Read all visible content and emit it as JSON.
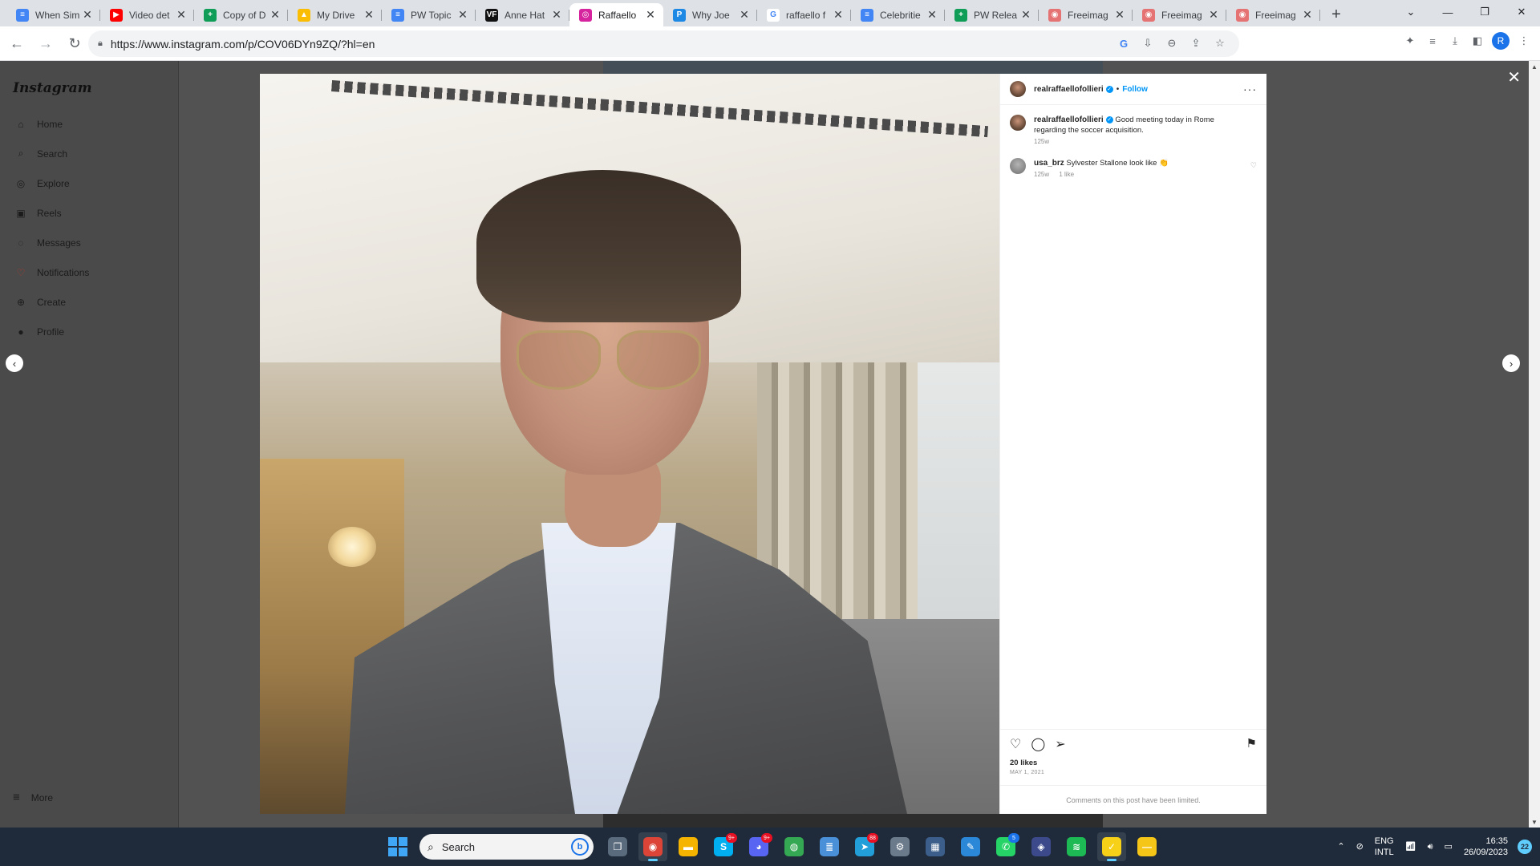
{
  "browser": {
    "tabs": [
      {
        "title": "When Sim",
        "color": "#4285f4",
        "glyph": "≡"
      },
      {
        "title": "Video det",
        "color": "#ff0000",
        "glyph": "▶"
      },
      {
        "title": "Copy of D",
        "color": "#0f9d58",
        "glyph": "+"
      },
      {
        "title": "My Drive",
        "color": "#fbbc04",
        "glyph": "▲"
      },
      {
        "title": "PW Topic",
        "color": "#4285f4",
        "glyph": "≡"
      },
      {
        "title": "Anne Hat",
        "color": "#111111",
        "glyph": "VF"
      },
      {
        "title": "Raffaello",
        "color": "#d6249f",
        "glyph": "◎"
      },
      {
        "title": "Why Joe",
        "color": "#1e88e5",
        "glyph": "P"
      },
      {
        "title": "raffaello f",
        "color": "#ffffff",
        "glyph": "G"
      },
      {
        "title": "Celebritie",
        "color": "#4285f4",
        "glyph": "≡"
      },
      {
        "title": "PW Relea",
        "color": "#0f9d58",
        "glyph": "+"
      },
      {
        "title": "Freeimag",
        "color": "#e57373",
        "glyph": "◉"
      },
      {
        "title": "Freeimag",
        "color": "#e57373",
        "glyph": "◉"
      },
      {
        "title": "Freeimag",
        "color": "#e57373",
        "glyph": "◉"
      }
    ],
    "active_tab_index": 6,
    "url": "https://www.instagram.com/p/COV06DYn9ZQ/?hl=en",
    "profile_initial": "R"
  },
  "instagram": {
    "logo": "Instagram",
    "nav": [
      {
        "label": "Home",
        "icon": "home-icon",
        "glyph": "⌂"
      },
      {
        "label": "Search",
        "icon": "search-icon",
        "glyph": "⌕"
      },
      {
        "label": "Explore",
        "icon": "compass-icon",
        "glyph": "◎"
      },
      {
        "label": "Reels",
        "icon": "reels-icon",
        "glyph": "▣"
      },
      {
        "label": "Messages",
        "icon": "messenger-icon",
        "glyph": "◌"
      },
      {
        "label": "Notifications",
        "icon": "heart-icon",
        "glyph": "♡"
      },
      {
        "label": "Create",
        "icon": "plus-icon",
        "glyph": "⊕"
      },
      {
        "label": "Profile",
        "icon": "profile-avatar",
        "glyph": "●"
      }
    ],
    "more_label": "More",
    "post": {
      "username": "realraffaellofollieri",
      "follow_label": "Follow",
      "caption": "Good meeting today in Rome regarding the soccer acquisition.",
      "caption_age": "125w",
      "comments": [
        {
          "username": "usa_brz",
          "text": "Sylvester Stallone look like 👏",
          "age": "125w",
          "likes": "1 like"
        }
      ],
      "likes": "20 likes",
      "date": "MAY 1, 2021",
      "comments_limited": "Comments on this post have been limited."
    }
  },
  "taskbar": {
    "search_placeholder": "Search",
    "apps": [
      {
        "name": "task-view",
        "color": "#5a6b7d",
        "glyph": "❐",
        "badge": ""
      },
      {
        "name": "chrome",
        "color": "#db4437",
        "glyph": "◉",
        "badge": "",
        "active": true
      },
      {
        "name": "file-explorer",
        "color": "#f4b400",
        "glyph": "▬",
        "badge": ""
      },
      {
        "name": "skype",
        "color": "#00aff0",
        "glyph": "S",
        "badge": "9+"
      },
      {
        "name": "discord",
        "color": "#5865f2",
        "glyph": "◕",
        "badge": "9+"
      },
      {
        "name": "maps",
        "color": "#34a853",
        "glyph": "◍",
        "badge": ""
      },
      {
        "name": "notepad",
        "color": "#4a90d9",
        "glyph": "≣",
        "badge": ""
      },
      {
        "name": "telegram",
        "color": "#229ed9",
        "glyph": "➤",
        "badge": "88"
      },
      {
        "name": "settings",
        "color": "#6b7b8c",
        "glyph": "⚙",
        "badge": ""
      },
      {
        "name": "calculator",
        "color": "#3b5f8a",
        "glyph": "▦",
        "badge": ""
      },
      {
        "name": "paint",
        "color": "#2b88d8",
        "glyph": "✎",
        "badge": ""
      },
      {
        "name": "whatsapp",
        "color": "#25d366",
        "glyph": "✆",
        "badge": "5"
      },
      {
        "name": "vpn",
        "color": "#3c4a8c",
        "glyph": "◈",
        "badge": ""
      },
      {
        "name": "spotify",
        "color": "#1db954",
        "glyph": "≋",
        "badge": ""
      },
      {
        "name": "norton",
        "color": "#f7d117",
        "glyph": "✓",
        "badge": "",
        "active": true
      },
      {
        "name": "app-yellow",
        "color": "#f5c518",
        "glyph": "—",
        "badge": ""
      }
    ],
    "tray": {
      "language_top": "ENG",
      "language_bottom": "INTL",
      "time": "16:35",
      "date": "26/09/2023",
      "notifications": "22"
    }
  }
}
